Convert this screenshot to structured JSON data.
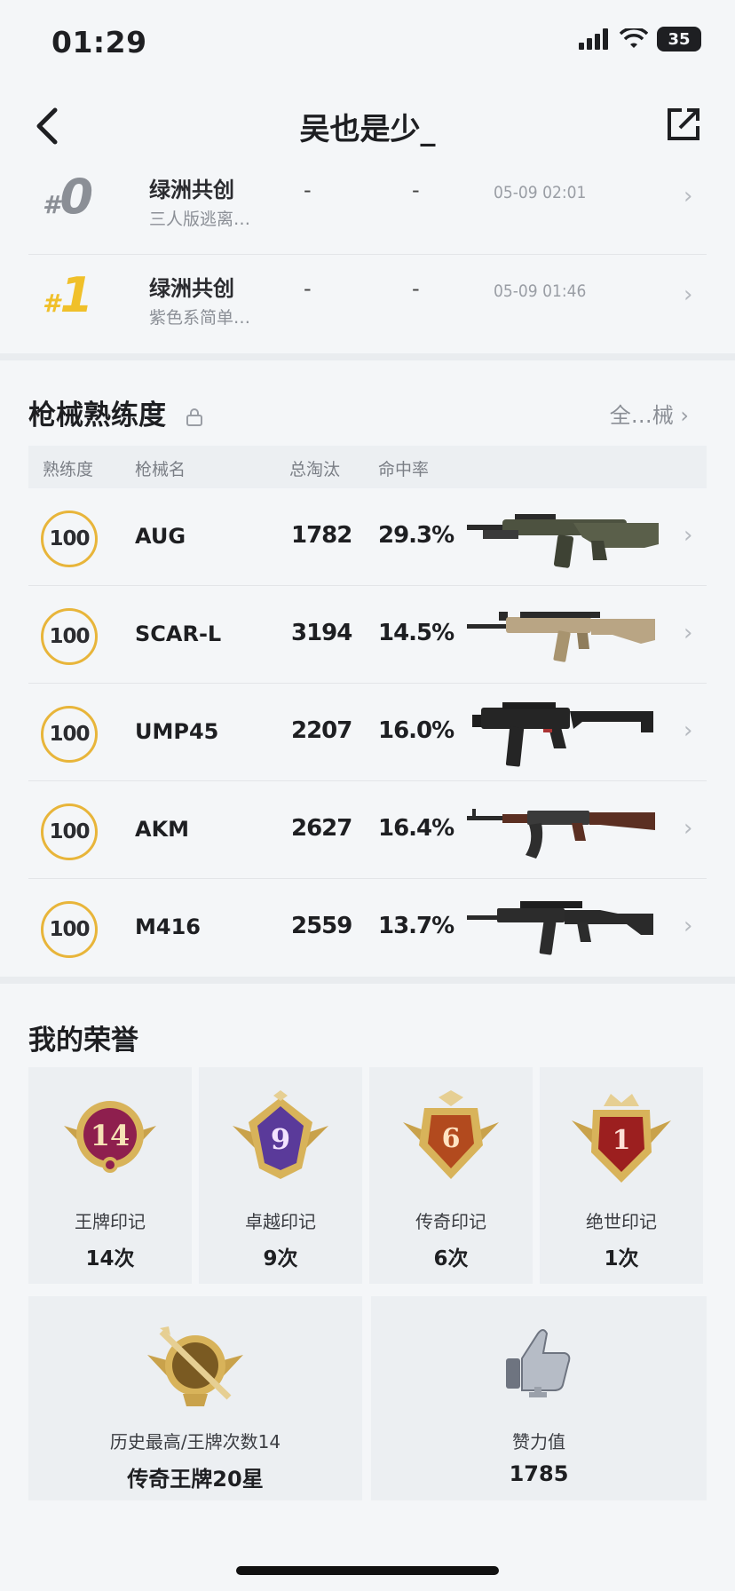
{
  "status": {
    "time": "01:29",
    "battery": "35"
  },
  "header": {
    "title": "吴也是少_"
  },
  "matches": [
    {
      "rank_hash": "#",
      "rank": "0",
      "title": "绿洲共创",
      "subtitle": "三人版逃离…",
      "col1": "-",
      "col2": "-",
      "time": "05-09 02:01"
    },
    {
      "rank_hash": "#",
      "rank": "1",
      "title": "绿洲共创",
      "subtitle": "紫色系简单…",
      "col1": "-",
      "col2": "-",
      "time": "05-09 01:46"
    }
  ],
  "weapons_section": {
    "title": "枪械熟练度",
    "link": "全…械",
    "headers": {
      "proficiency": "熟练度",
      "name": "枪械名",
      "kills": "总淘汰",
      "accuracy": "命中率"
    },
    "rows": [
      {
        "proficiency": "100",
        "name": "AUG",
        "kills": "1782",
        "accuracy": "29.3%"
      },
      {
        "proficiency": "100",
        "name": "SCAR-L",
        "kills": "3194",
        "accuracy": "14.5%"
      },
      {
        "proficiency": "100",
        "name": "UMP45",
        "kills": "2207",
        "accuracy": "16.0%"
      },
      {
        "proficiency": "100",
        "name": "AKM",
        "kills": "2627",
        "accuracy": "16.4%"
      },
      {
        "proficiency": "100",
        "name": "M416",
        "kills": "2559",
        "accuracy": "13.7%"
      }
    ]
  },
  "honors": {
    "title": "我的荣誉",
    "badges": [
      {
        "num": "14",
        "name": "王牌印记",
        "count": "14次"
      },
      {
        "num": "9",
        "name": "卓越印记",
        "count": "9次"
      },
      {
        "num": "6",
        "name": "传奇印记",
        "count": "6次"
      },
      {
        "num": "1",
        "name": "绝世印记",
        "count": "1次"
      }
    ],
    "best": {
      "label": "历史最高/王牌次数14",
      "value": "传奇王牌20星"
    },
    "likes": {
      "label": "赞力值",
      "value": "1785"
    }
  },
  "colors": {
    "gold": "#e8b53a",
    "rank1": "#f0c02a",
    "rank0": "#8b8f96"
  }
}
